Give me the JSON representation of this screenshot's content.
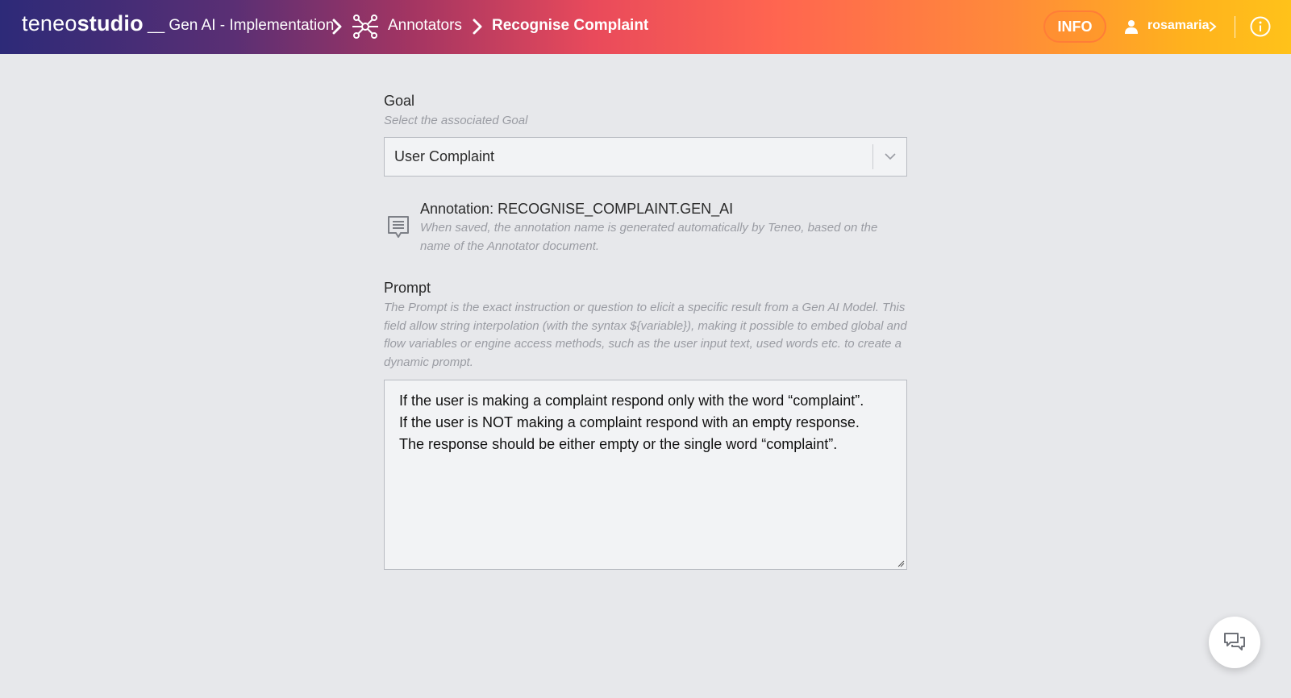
{
  "header": {
    "logo_light": "teneo",
    "logo_bold": "studio",
    "breadcrumb": {
      "project": "__ Gen AI - Implementation",
      "section": "Annotators",
      "current": "Recognise Complaint"
    },
    "info_label": "INFO",
    "user_name": "rosamaria",
    "icons": {
      "section_icon": "network-hub-icon",
      "user_icon": "user-icon",
      "help_icon": "info-circle-icon"
    }
  },
  "goal": {
    "label": "Goal",
    "hint": "Select the associated Goal",
    "selected": "User Complaint"
  },
  "annotation": {
    "title": "Annotation: RECOGNISE_COMPLAINT.GEN_AI",
    "hint": "When saved, the annotation name is generated automatically by Teneo, based on the name of the Annotator document."
  },
  "prompt": {
    "label": "Prompt",
    "hint": "The Prompt is the exact instruction or question to elicit a specific result from a Gen AI Model. This field allow string interpolation (with the syntax ${variable}), making it possible to embed global and flow variables or engine access methods, such as the user input text, used words etc. to create a dynamic prompt.",
    "lines": [
      "If the user is making a complaint respond only with the word “complaint”.",
      "If the user is NOT making a complaint respond with an empty response.",
      "The response should be either empty or the single word “complaint”."
    ]
  },
  "colors": {
    "accent_info_border": "#ff7d37",
    "page_bg": "#e7e8eb"
  }
}
